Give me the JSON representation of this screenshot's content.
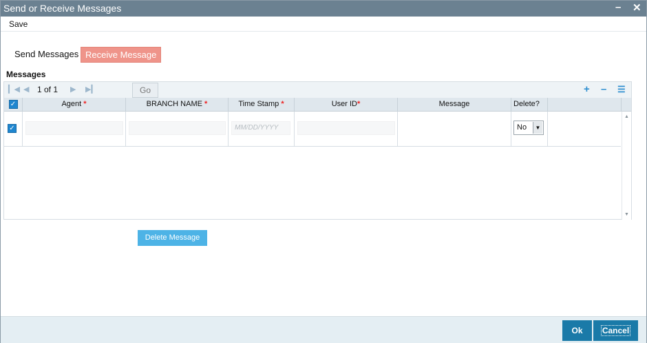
{
  "window": {
    "title": "Send or Receive Messages",
    "minimize_icon": "minimize-icon",
    "close_icon": "close-icon"
  },
  "menu": {
    "save_label": "Save"
  },
  "tabs": [
    {
      "label": "Send Messages",
      "active": false
    },
    {
      "label": "Receive Message",
      "active": true
    }
  ],
  "section": {
    "label": "Messages"
  },
  "pager": {
    "text": "1 of 1",
    "go_label": "Go",
    "icons": [
      "first-page-icon",
      "prev-page-icon",
      "next-page-icon",
      "last-page-icon"
    ],
    "actions": [
      "add-row-icon",
      "remove-row-icon",
      "list-view-icon"
    ]
  },
  "table": {
    "columns": [
      {
        "label": "Agent",
        "required": true
      },
      {
        "label": "BRANCH NAME",
        "required": true
      },
      {
        "label": "Time Stamp",
        "required": true
      },
      {
        "label": "User ID",
        "required": true
      },
      {
        "label": "Message",
        "required": false
      },
      {
        "label": "Delete?",
        "required": false
      }
    ],
    "header_checked": true,
    "rows": [
      {
        "checked": true,
        "agent": "",
        "branch_name": "",
        "timestamp_placeholder": "MM/DD/YYYY",
        "user_id": "",
        "message": "",
        "delete": "No"
      }
    ]
  },
  "buttons": {
    "delete_message": "Delete Message",
    "ok": "Ok",
    "cancel": "Cancel"
  },
  "colors": {
    "titlebar": "#6b8191",
    "active_tab": "#ef948a",
    "primary_button": "#1a7aa8",
    "delete_button": "#4db3e6",
    "checkbox": "#1f86cf"
  }
}
